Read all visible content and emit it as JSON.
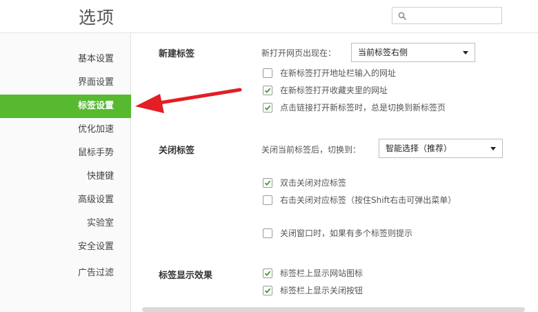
{
  "header": {
    "title": "选项",
    "search_placeholder": ""
  },
  "sidebar": {
    "items": [
      {
        "label": "基本设置"
      },
      {
        "label": "界面设置"
      },
      {
        "label": "标签设置"
      },
      {
        "label": "优化加速"
      },
      {
        "label": "鼠标手势"
      },
      {
        "label": "快捷键"
      },
      {
        "label": "高级设置"
      },
      {
        "label": "实验室"
      },
      {
        "label": "安全设置"
      },
      {
        "label": "广告过滤"
      }
    ],
    "active_index": 2
  },
  "colors": {
    "accent": "#56b930",
    "arrow": "#e31e24"
  },
  "sections": {
    "new_tab": {
      "title": "新建标签",
      "open_label": "新打开网页出现在：",
      "open_value": "当前标签右侧",
      "options": [
        {
          "label": "在新标签打开地址栏输入的网址",
          "checked": false
        },
        {
          "label": "在新标签打开收藏夹里的网址",
          "checked": true
        },
        {
          "label": "点击链接打开新标签时，总是切换到新标签页",
          "checked": true
        }
      ]
    },
    "close_tab": {
      "title": "关闭标签",
      "switch_label": "关闭当前标签后，切换到：",
      "switch_value": "智能选择（推荐）",
      "options": [
        {
          "label": "双击关闭对应标签",
          "checked": true
        },
        {
          "label": "右击关闭对应标签（按住Shift右击可弹出菜单）",
          "checked": false
        },
        {
          "label": "关闭窗口时，如果有多个标签则提示",
          "checked": false
        }
      ]
    },
    "tab_display": {
      "title": "标签显示效果",
      "options": [
        {
          "label": "标签栏上显示网站图标",
          "checked": true
        },
        {
          "label": "标签栏上显示关闭按钮",
          "checked": true
        }
      ]
    }
  }
}
